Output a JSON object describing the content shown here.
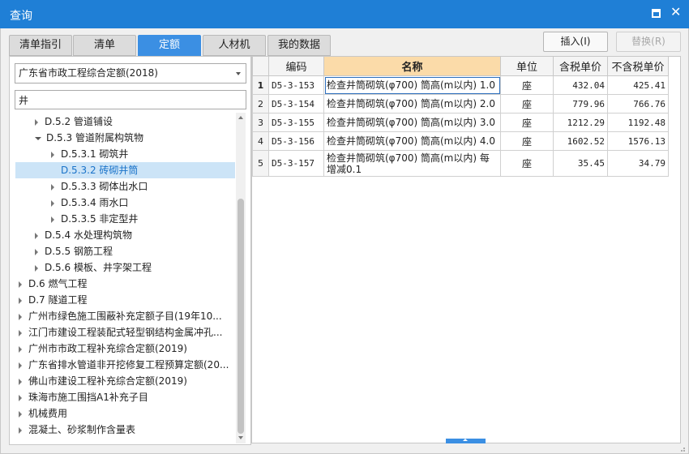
{
  "window": {
    "title": "查询"
  },
  "tabs": [
    {
      "label": "清单指引",
      "active": false
    },
    {
      "label": "清单",
      "active": false
    },
    {
      "label": "定额",
      "active": true
    },
    {
      "label": "人材机",
      "active": false
    },
    {
      "label": "我的数据",
      "active": false
    }
  ],
  "toolbar": {
    "insert_label": "插入(I)",
    "replace_label": "替换(R)"
  },
  "library": {
    "selected": "广东省市政工程综合定额(2018)"
  },
  "search": {
    "value": "井",
    "placeholder": ""
  },
  "tree": [
    {
      "label": "D.5.2 管道铺设",
      "level": 1,
      "toggle": "closed"
    },
    {
      "label": "D.5.3 管道附属构筑物",
      "level": 1,
      "toggle": "open"
    },
    {
      "label": "D.5.3.1 砌筑井",
      "level": 2,
      "toggle": "closed"
    },
    {
      "label": "D.5.3.2 砖砌井筒",
      "level": 2,
      "toggle": "none",
      "selected": true
    },
    {
      "label": "D.5.3.3 砌体出水口",
      "level": 2,
      "toggle": "closed"
    },
    {
      "label": "D.5.3.4 雨水口",
      "level": 2,
      "toggle": "closed"
    },
    {
      "label": "D.5.3.5 非定型井",
      "level": 2,
      "toggle": "closed"
    },
    {
      "label": "D.5.4 水处理构筑物",
      "level": 1,
      "toggle": "closed"
    },
    {
      "label": "D.5.5 钢筋工程",
      "level": 1,
      "toggle": "closed"
    },
    {
      "label": "D.5.6 模板、井字架工程",
      "level": 1,
      "toggle": "closed"
    },
    {
      "label": "D.6 燃气工程",
      "level": 0,
      "toggle": "closed"
    },
    {
      "label": "D.7 隧道工程",
      "level": 0,
      "toggle": "closed"
    },
    {
      "label": "广州市绿色施工围蔽补充定额子目(19年10...",
      "level": 0,
      "toggle": "closed"
    },
    {
      "label": "江门市建设工程装配式轻型钢结构金属冲孔...",
      "level": 0,
      "toggle": "closed"
    },
    {
      "label": "广州市市政工程补充综合定额(2019)",
      "level": 0,
      "toggle": "closed"
    },
    {
      "label": "广东省排水管道非开挖修复工程预算定额(20...",
      "level": 0,
      "toggle": "closed"
    },
    {
      "label": "佛山市建设工程补充综合定额(2019)",
      "level": 0,
      "toggle": "closed"
    },
    {
      "label": "珠海市施工围挡A1补充子目",
      "level": 0,
      "toggle": "closed"
    },
    {
      "label": "机械费用",
      "level": 0,
      "toggle": "closed"
    },
    {
      "label": "混凝土、砂浆制作含量表",
      "level": 0,
      "toggle": "closed"
    }
  ],
  "grid": {
    "columns": [
      "",
      "编码",
      "名称",
      "单位",
      "含税单价",
      "不含税单价"
    ],
    "rows": [
      {
        "n": "1",
        "code": "D5-3-153",
        "name": "检查井筒砌筑(φ700) 筒高(m以内) 1.0",
        "unit": "座",
        "price_tax": "432.04",
        "price_notax": "425.41"
      },
      {
        "n": "2",
        "code": "D5-3-154",
        "name": "检查井筒砌筑(φ700) 筒高(m以内) 2.0",
        "unit": "座",
        "price_tax": "779.96",
        "price_notax": "766.76"
      },
      {
        "n": "3",
        "code": "D5-3-155",
        "name": "检查井筒砌筑(φ700) 筒高(m以内) 3.0",
        "unit": "座",
        "price_tax": "1212.29",
        "price_notax": "1192.48"
      },
      {
        "n": "4",
        "code": "D5-3-156",
        "name": "检查井筒砌筑(φ700) 筒高(m以内) 4.0",
        "unit": "座",
        "price_tax": "1602.52",
        "price_notax": "1576.13"
      },
      {
        "n": "5",
        "code": "D5-3-157",
        "name": "检查井筒砌筑(φ700) 筒高(m以内) 每增减0.1",
        "unit": "座",
        "price_tax": "35.45",
        "price_notax": "34.79"
      }
    ]
  },
  "icons": {
    "maximize": "maximize-icon",
    "close": "close-icon",
    "dropdown": "chevron-down-icon"
  },
  "colors": {
    "titlebar": "#1f7fd6",
    "active_tab": "#3b8fe3",
    "selected_row": "#cce4f7",
    "name_header": "#fbdba9"
  }
}
